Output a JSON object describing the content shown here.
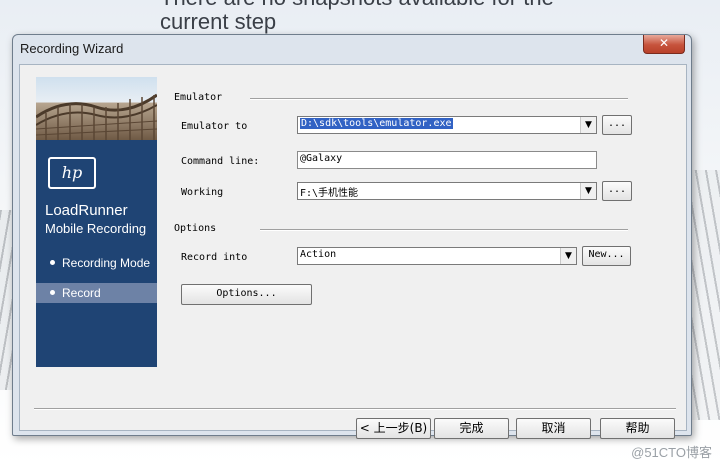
{
  "background": {
    "slide_heading": "There are no snapshots available for the current step",
    "watermark": "@51CTO博客"
  },
  "window": {
    "title": "Recording Wizard",
    "close_glyph": "✕"
  },
  "banner": {
    "logo": "hp",
    "brand_line1": "LoadRunner",
    "brand_line2": "Mobile Recording",
    "steps": [
      {
        "label": "Recording Mode",
        "active": false
      },
      {
        "label": "Record",
        "active": true
      }
    ]
  },
  "form": {
    "emulator_section": "Emulator",
    "emulator_to_label": "Emulator to",
    "emulator_to_value": "D:\\sdk\\tools\\emulator.exe",
    "command_line_label": "Command line:",
    "command_line_value": "@Galaxy",
    "working_label": "Working",
    "working_value": "F:\\手机性能",
    "browse_label": "...",
    "options_section": "Options",
    "record_into_label": "Record into",
    "record_into_value": "Action",
    "new_button": "New...",
    "options_button": "Options..."
  },
  "footer": {
    "back_button": "< 上一步(B)",
    "finish_button": "完成",
    "cancel_button": "取消",
    "help_button": "帮助"
  },
  "icons": {
    "dropdown": "chevron-down-icon",
    "close": "close-icon",
    "bullet": "bullet-icon"
  }
}
